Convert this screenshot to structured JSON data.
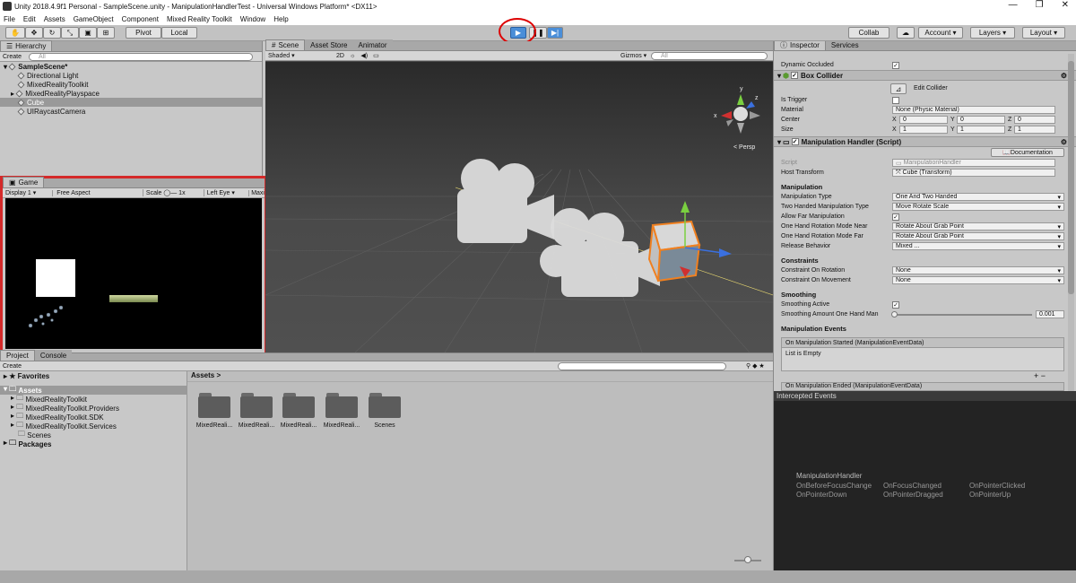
{
  "title_bar": {
    "title": "Unity 2018.4.9f1 Personal - SampleScene.unity - ManipulationHandlerTest - Universal Windows Platform* <DX11>",
    "minimize": "—",
    "maximize": "❐",
    "close": "✕"
  },
  "menu": [
    "File",
    "Edit",
    "Assets",
    "GameObject",
    "Component",
    "Mixed Reality Toolkit",
    "Window",
    "Help"
  ],
  "toolbar": {
    "pivot": "Pivot",
    "local": "Local",
    "collab": "Collab",
    "account": "Account",
    "layers": "Layers",
    "layout": "Layout"
  },
  "hierarchy": {
    "tab": "Hierarchy",
    "create": "Create",
    "search": "All",
    "scene": "SampleScene*",
    "items": [
      "Directional Light",
      "MixedRealityToolkit",
      "MixedRealityPlayspace",
      "Cube",
      "UIRaycastCamera"
    ]
  },
  "scene": {
    "tabs": [
      "Scene",
      "Asset Store",
      "Animator"
    ],
    "shaded": "Shaded",
    "mode2d": "2D",
    "gizmos": "Gizmos",
    "search": "All",
    "persp": "< Persp",
    "axis": {
      "x": "x",
      "y": "y",
      "z": "z"
    }
  },
  "game": {
    "tab": "Game",
    "display": "Display 1",
    "aspect": "Free Aspect",
    "scale_label": "Scale",
    "scale_val": "1x",
    "eye": "Left Eye",
    "maxi": "Maxi"
  },
  "project": {
    "tabs": [
      "Project",
      "Console"
    ],
    "create": "Create",
    "favorites": "Favorites",
    "assets_root": "Assets",
    "tree": [
      "MixedRealityToolkit",
      "MixedRealityToolkit.Providers",
      "MixedRealityToolkit.SDK",
      "MixedRealityToolkit.Services",
      "Scenes"
    ],
    "packages": "Packages",
    "breadcrumb": "Assets",
    "folders": [
      "MixedReali...",
      "MixedReali...",
      "MixedReali...",
      "MixedReali...",
      "Scenes"
    ]
  },
  "inspector": {
    "tabs": [
      "Inspector",
      "Services"
    ],
    "dynamic_occluded": "Dynamic Occluded",
    "box_collider": {
      "title": "Box Collider",
      "edit": "Edit Collider",
      "is_trigger": "Is Trigger",
      "material_label": "Material",
      "material_value": "None (Physic Material)",
      "center_label": "Center",
      "center": [
        "0",
        "0",
        "0"
      ],
      "size_label": "Size",
      "size": [
        "1",
        "1",
        "1"
      ],
      "axes": [
        "X",
        "Y",
        "Z"
      ]
    },
    "manip": {
      "title": "Manipulation Handler (Script)",
      "documentation": "Documentation",
      "script_label": "Script",
      "script_value": "ManipulationHandler",
      "host_label": "Host Transform",
      "host_value": "Cube (Transform)",
      "sec_manip": "Manipulation",
      "type_label": "Manipulation Type",
      "type_value": "One And Two Handed",
      "two_label": "Two Handed Manipulation Type",
      "two_value": "Move Rotate Scale",
      "far_label": "Allow Far Manipulation",
      "near_label": "One Hand Rotation Mode Near",
      "near_value": "Rotate About Grab Point",
      "farm_label": "One Hand Rotation Mode Far",
      "farm_value": "Rotate About Grab Point",
      "release_label": "Release Behavior",
      "release_value": "Mixed ...",
      "sec_constraints": "Constraints",
      "rot_label": "Constraint On Rotation",
      "rot_value": "None",
      "mov_label": "Constraint On Movement",
      "mov_value": "None",
      "sec_smoothing": "Smoothing",
      "smooth_active": "Smoothing Active",
      "smooth_amount": "Smoothing Amount One Hand Man",
      "smooth_value": "0.001",
      "sec_events": "Manipulation Events",
      "started": "On Manipulation Started (ManipulationEventData)",
      "empty": "List is Empty",
      "ended": "On Manipulation Ended (ManipulationEventData)"
    }
  },
  "events": {
    "title": "Intercepted Events",
    "handler": "ManipulationHandler",
    "items": [
      "OnBeforeFocusChange",
      "OnFocusChanged",
      "OnPointerClicked",
      "OnPointerDown",
      "OnPointerDragged",
      "OnPointerUp"
    ]
  }
}
